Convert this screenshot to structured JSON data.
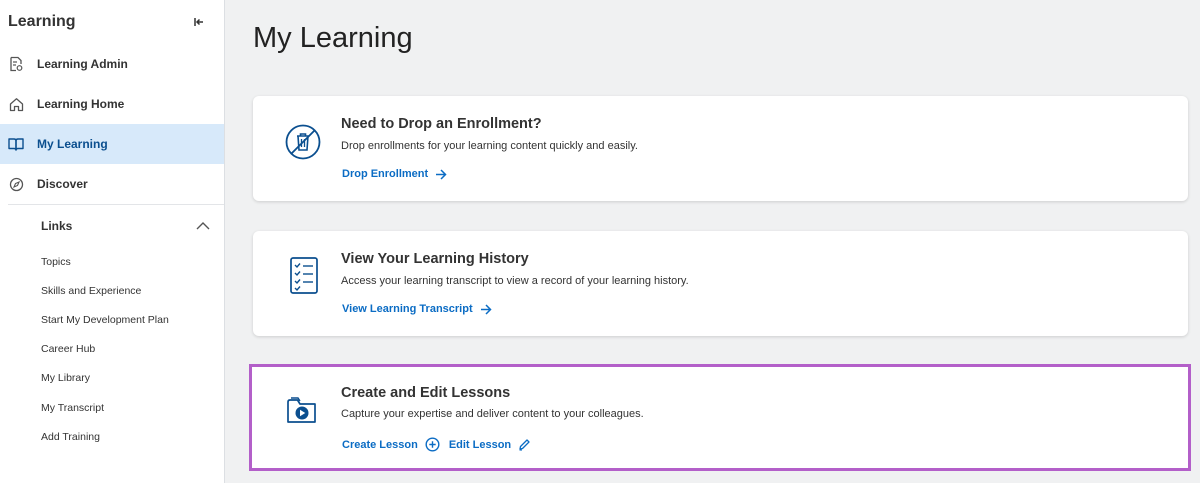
{
  "sidebar": {
    "title": "Learning",
    "nav": [
      {
        "label": "Learning Admin",
        "icon": "admin-doc-icon"
      },
      {
        "label": "Learning Home",
        "icon": "home-icon"
      },
      {
        "label": "My Learning",
        "icon": "book-icon",
        "active": true
      },
      {
        "label": "Discover",
        "icon": "compass-icon"
      }
    ],
    "links_header": "Links",
    "links": [
      "Topics",
      "Skills and Experience",
      "Start My Development Plan",
      "Career Hub",
      "My Library",
      "My Transcript",
      "Add Training"
    ]
  },
  "main": {
    "title": "My Learning",
    "cards": [
      {
        "title": "Need to Drop an Enrollment?",
        "description": "Drop enrollments for your learning content quickly and easily.",
        "links": [
          {
            "label": "Drop Enrollment",
            "icon": "arrow-right-icon"
          }
        ]
      },
      {
        "title": "View Your Learning History",
        "description": "Access your learning transcript to view a record of your learning history.",
        "links": [
          {
            "label": "View Learning Transcript",
            "icon": "arrow-right-icon"
          }
        ]
      },
      {
        "title": "Create and Edit Lessons",
        "description": "Capture your expertise and deliver content to your colleagues.",
        "links": [
          {
            "label": "Create Lesson",
            "icon": "plus-circle-icon"
          },
          {
            "label": "Edit Lesson",
            "icon": "pencil-icon"
          }
        ]
      }
    ]
  },
  "colors": {
    "accent": "#0b6cc4",
    "active_nav_bg": "#d7e9fa",
    "highlight_border": "#b35fc9"
  }
}
